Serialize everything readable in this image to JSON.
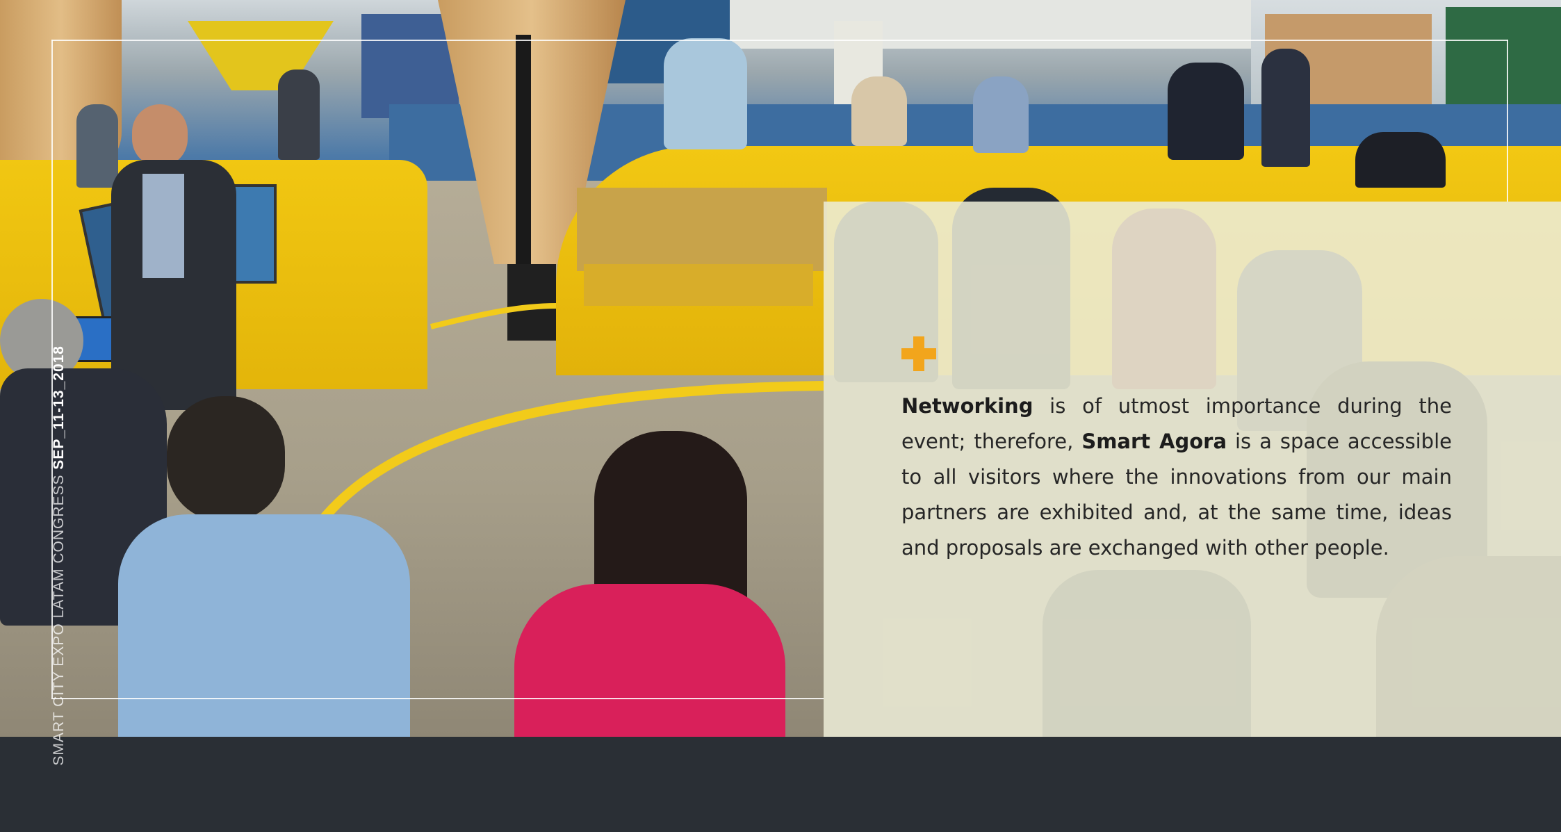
{
  "brochure": {
    "event_name": "SMART CITY EXPO LATAM CONGRESS ",
    "event_dates": "SEP_11-13_2018",
    "paragraph": {
      "term1": "Networking",
      "part1": " is of utmost importance  during the event; therefore, ",
      "term2": "Smart Agora",
      "part2": " is a space accessible to all visitors where the innovations from our main partners are exhibited and, at the same time, ideas and proposals are exchanged with other people."
    },
    "accent_color": "#f2a51c",
    "icons": [
      "plus-icon"
    ]
  }
}
